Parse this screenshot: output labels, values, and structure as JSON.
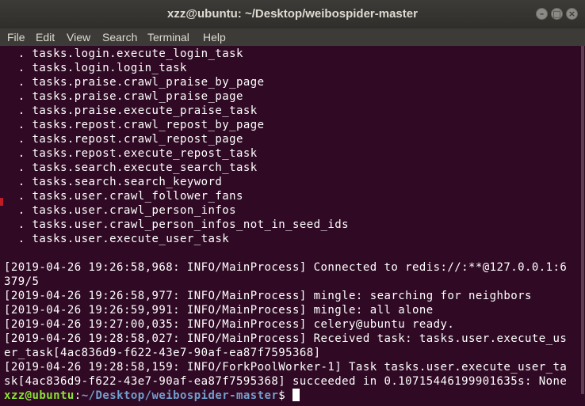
{
  "window": {
    "title": "xzz@ubuntu: ~/Desktop/weibospider-master",
    "buttons": {
      "minimize": "–",
      "maximize": "□",
      "close": "×"
    }
  },
  "menu": [
    "File",
    "Edit",
    "View",
    "Search",
    "Terminal",
    "Help"
  ],
  "tasks": [
    "  . tasks.login.execute_login_task",
    "  . tasks.login.login_task",
    "  . tasks.praise.crawl_praise_by_page",
    "  . tasks.praise.crawl_praise_page",
    "  . tasks.praise.execute_praise_task",
    "  . tasks.repost.crawl_repost_by_page",
    "  . tasks.repost.crawl_repost_page",
    "  . tasks.repost.execute_repost_task",
    "  . tasks.search.execute_search_task",
    "  . tasks.search.search_keyword",
    "  . tasks.user.crawl_follower_fans",
    "  . tasks.user.crawl_person_infos",
    "  . tasks.user.crawl_person_infos_not_in_seed_ids",
    "  . tasks.user.execute_user_task"
  ],
  "log": [
    "[2019-04-26 19:26:58,968: INFO/MainProcess] Connected to redis://:**@127.0.0.1:6",
    "379/5",
    "[2019-04-26 19:26:58,977: INFO/MainProcess] mingle: searching for neighbors",
    "[2019-04-26 19:26:59,991: INFO/MainProcess] mingle: all alone",
    "[2019-04-26 19:27:00,035: INFO/MainProcess] celery@ubuntu ready.",
    "[2019-04-26 19:28:58,027: INFO/MainProcess] Received task: tasks.user.execute_us",
    "er_task[4ac836d9-f622-43e7-90af-ea87f7595368]",
    "[2019-04-26 19:28:58,159: INFO/ForkPoolWorker-1] Task tasks.user.execute_user_ta",
    "sk[4ac836d9-f622-43e7-90af-ea87f7595368] succeeded in 0.10715446199901635s: None"
  ],
  "prompt": {
    "user": "xzz@ubuntu",
    "sep": ":",
    "path": "~/Desktop/weibospider-master",
    "symbol": "$ "
  },
  "colors": {
    "background": "#300a24",
    "prompt_user": "#8ae234",
    "prompt_path": "#729fcf",
    "text": "#ffffff"
  }
}
